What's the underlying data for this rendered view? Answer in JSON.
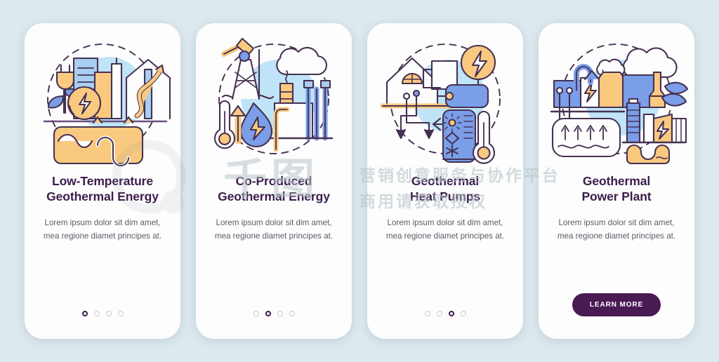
{
  "theme": {
    "page_background": "#dde9ee",
    "card_background": "#fdfdfd",
    "title_color": "#3b1d4b",
    "body_color": "#5d5a66",
    "accent_purple": "#4a1a52",
    "illustration_orange": "#fac980",
    "illustration_blue": "#7a9ee8",
    "illustration_light_blue": "#bfe4f8",
    "illustration_outline": "#463152",
    "dot_inactive": "#c9c7d2"
  },
  "watermark": {
    "line1": "营销创意服务与协作平台",
    "line2": "商用请获取授权",
    "brand": "千图"
  },
  "screens": [
    {
      "id": "low-temperature-geothermal-energy",
      "illustration": "geothermal-buildings-loop-icon",
      "title_line1": "Low-Temperature",
      "title_line2": "Geothermal Energy",
      "description": "Lorem ipsum dolor sit dim amet, mea regione diamet principes at.",
      "dots": 4,
      "active_dot": 1,
      "has_button": false,
      "button_label": ""
    },
    {
      "id": "co-produced-geothermal-energy",
      "illustration": "oil-rig-factory-droplet-icon",
      "title_line1": "Co-Produced",
      "title_line2": "Geothermal Energy",
      "description": "Lorem ipsum dolor sit dim amet, mea regione diamet principes at.",
      "dots": 4,
      "active_dot": 2,
      "has_button": false,
      "button_label": ""
    },
    {
      "id": "geothermal-heat-pumps",
      "illustration": "house-heat-pump-thermometer-icon",
      "title_line1": "Geothermal",
      "title_line2": "Heat Pumps",
      "description": "Lorem ipsum dolor sit dim amet, mea regione diamet principes at.",
      "dots": 4,
      "active_dot": 3,
      "has_button": false,
      "button_label": ""
    },
    {
      "id": "geothermal-power-plant",
      "illustration": "power-plant-turbine-reservoir-icon",
      "title_line1": "Geothermal",
      "title_line2": "Power Plant",
      "description": "Lorem ipsum dolor sit dim amet, mea regione diamet principes at.",
      "dots": 0,
      "active_dot": 0,
      "has_button": true,
      "button_label": "LEARN MORE"
    }
  ]
}
